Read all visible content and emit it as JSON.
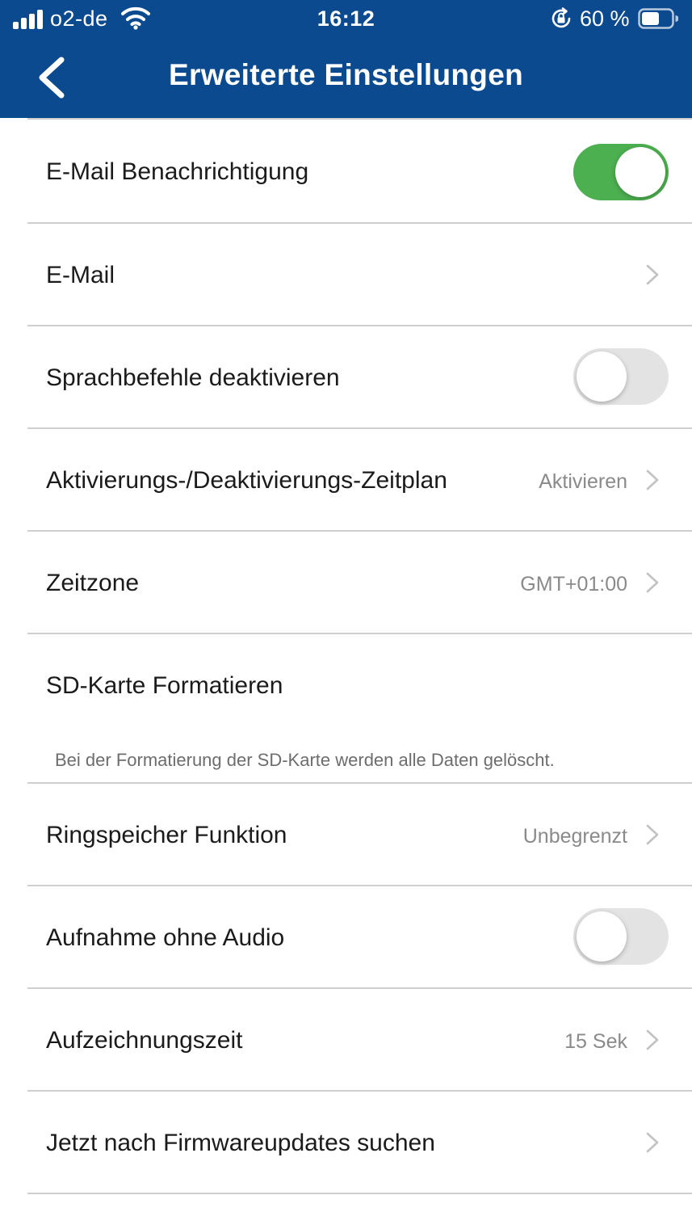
{
  "status_bar": {
    "carrier": "o2-de",
    "time": "16:12",
    "battery_percent": "60 %",
    "battery_level": 0.6,
    "icons": [
      "signal-icon",
      "wifi-icon",
      "rotation-lock-icon",
      "battery-icon"
    ]
  },
  "header": {
    "title": "Erweiterte Einstellungen",
    "back_icon": "chevron-left-icon",
    "background_color": "#0b4a8f"
  },
  "settings": {
    "email_notification": {
      "label": "E-Mail Benachrichtigung",
      "enabled": true
    },
    "email": {
      "label": "E-Mail"
    },
    "voice_commands": {
      "label": "Sprachbefehle deaktivieren",
      "enabled": false
    },
    "schedule": {
      "label": "Aktivierungs-/Deaktivierungs-Zeitplan",
      "value": "Aktivieren"
    },
    "timezone": {
      "label": "Zeitzone",
      "value": "GMT+01:00"
    },
    "sd_format": {
      "label": "SD-Karte Formatieren",
      "hint": "Bei der Formatierung der SD-Karte werden alle Daten gelöscht."
    },
    "loop_recording": {
      "label": "Ringspeicher Funktion",
      "value": "Unbegrenzt"
    },
    "record_without_audio": {
      "label": "Aufnahme ohne Audio",
      "enabled": false
    },
    "recording_time": {
      "label": "Aufzeichnungszeit",
      "value": "15 Sek"
    },
    "firmware_check": {
      "label": "Jetzt nach Firmwareupdates suchen"
    }
  },
  "colors": {
    "toggle_on": "#4caf50",
    "toggle_off": "#e3e3e3",
    "value_text": "#8a8a8a"
  }
}
